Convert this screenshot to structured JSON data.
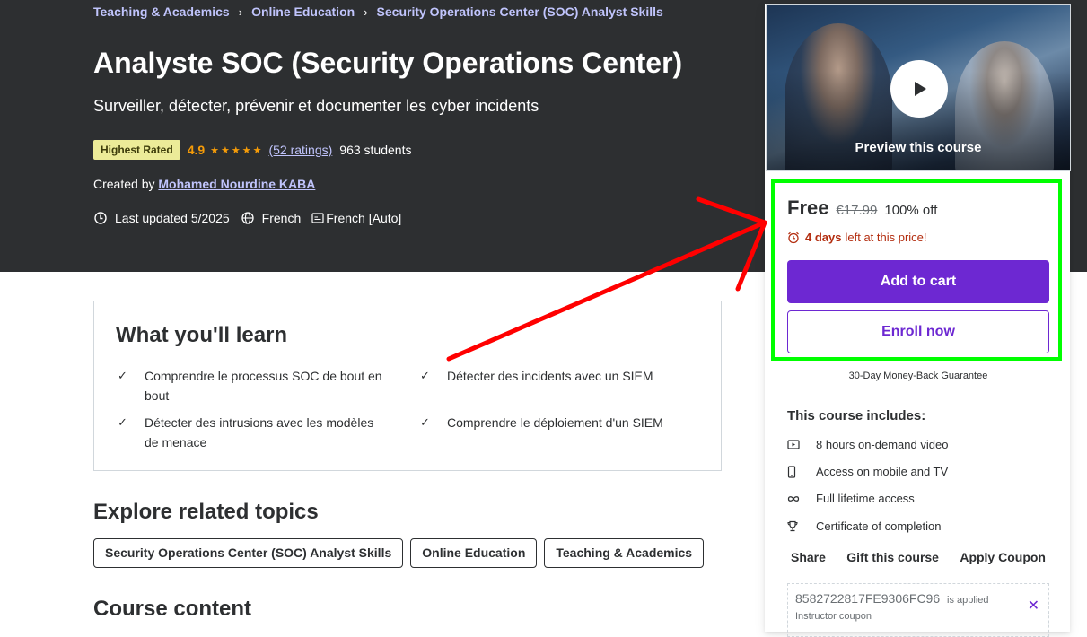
{
  "breadcrumb": {
    "items": [
      "Teaching & Academics",
      "Online Education",
      "Security Operations Center (SOC) Analyst Skills"
    ],
    "separator": "›"
  },
  "course": {
    "title": "Analyste SOC (Security Operations Center)",
    "subtitle": "Surveiller, détecter, prévenir et documenter les cyber incidents",
    "badge": "Highest Rated",
    "rating": "4.9",
    "stars": "★★★★★",
    "ratings_count": "(52 ratings)",
    "students": "963 students",
    "created_by_prefix": "Created by",
    "instructor": "Mohamed Nourdine KABA",
    "last_updated": "Last updated 5/2025",
    "language": "French",
    "captions": "French [Auto]"
  },
  "learn": {
    "title": "What you'll learn",
    "items": [
      "Comprendre le processus SOC de bout en bout",
      "Détecter des incidents avec un SIEM",
      "Détecter des intrusions avec les modèles de menace",
      "Comprendre le déploiement d'un SIEM"
    ]
  },
  "topics": {
    "title": "Explore related topics",
    "items": [
      "Security Operations Center (SOC) Analyst Skills",
      "Online Education",
      "Teaching & Academics"
    ]
  },
  "content": {
    "title": "Course content"
  },
  "sidebar": {
    "preview_label": "Preview this course",
    "price_free": "Free",
    "price_original": "€17.99",
    "discount": "100% off",
    "countdown_days": "4 days",
    "countdown_text": "left at this price!",
    "add_to_cart": "Add to cart",
    "enroll_now": "Enroll now",
    "guarantee": "30-Day Money-Back Guarantee",
    "includes_title": "This course includes:",
    "includes": [
      {
        "icon": "video-icon",
        "text": "8 hours on-demand video"
      },
      {
        "icon": "mobile-icon",
        "text": "Access on mobile and TV"
      },
      {
        "icon": "infinity-icon",
        "text": "Full lifetime access"
      },
      {
        "icon": "trophy-icon",
        "text": "Certificate of completion"
      }
    ],
    "links": [
      "Share",
      "Gift this course",
      "Apply Coupon"
    ],
    "coupon_code": "8582722817FE9306FC96",
    "coupon_applied": "is applied",
    "coupon_sub": "Instructor coupon"
  },
  "colors": {
    "hero_bg": "#2d2f31",
    "accent_purple": "#6d28d2",
    "link_lavender": "#c0c4fc",
    "rating_orange": "#f69c08",
    "countdown_red": "#b32d0f",
    "annotation_green": "#00ff00",
    "annotation_red": "#ff0000"
  }
}
